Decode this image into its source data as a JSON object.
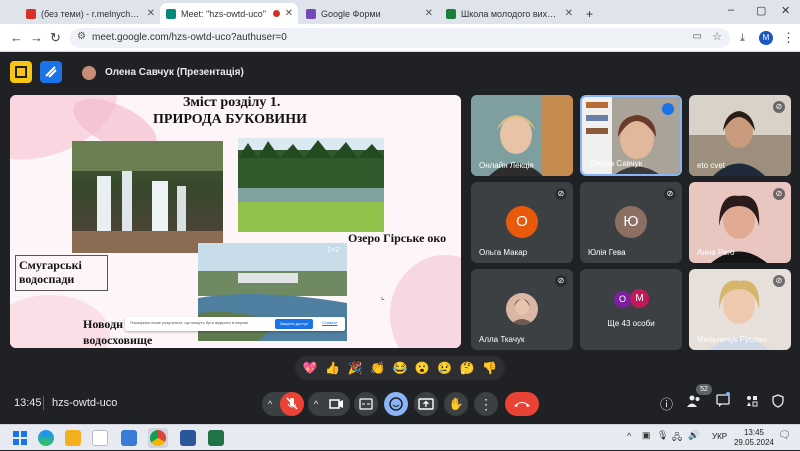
{
  "browser": {
    "tabs": [
      {
        "label": "(без теми) - r.melnychuk@ippo.",
        "favicon_color": "#d93025"
      },
      {
        "label": "Meet: \"hzs-owtd-uco\"",
        "favicon_color": "#00897b",
        "active": true
      },
      {
        "label": "Google Форми",
        "favicon_color": "#7248b9"
      },
      {
        "label": "Школа молодого вихователя",
        "favicon_color": "#188038"
      }
    ],
    "new_tab_label": "+",
    "url": "meet.google.com/hzs-owtd-uco?authuser=0",
    "profile_initial": "M",
    "window_controls": {
      "minimize": "–",
      "maximize": "▢",
      "close": "✕"
    }
  },
  "meet": {
    "presenter_label": "Олена Савчук (Презентація)",
    "slide": {
      "title_line1": "Зміст розділу 1.",
      "title_line2": "ПРИРОДА БУКОВИНИ",
      "caption_lake": "Озеро Гірське око",
      "caption_falls_line1": "Смугарські",
      "caption_falls_line2": "водоспади",
      "caption_reservoir_line1": "Новодн",
      "caption_reservoir_line2": "водосховище",
      "photo_badge": "1+2",
      "notice_text": "Показуємо лише результати, що можуть бути відкрити в мережі.",
      "notice_button": "Закрити доступ",
      "notice_link": "Сховати"
    },
    "participants": [
      {
        "name": "Онлайн Лекція",
        "type": "video",
        "muted": false
      },
      {
        "name": "Олена Савчук",
        "type": "video",
        "muted": false,
        "speaking": true
      },
      {
        "name": "eto cvet",
        "type": "video",
        "muted": true
      },
      {
        "name": "Ольга Макар",
        "type": "avatar",
        "initial": "О",
        "color": "#e8590c",
        "muted": true
      },
      {
        "name": "Юлія Гева",
        "type": "avatar",
        "initial": "Ю",
        "color": "#8d6e63",
        "muted": true
      },
      {
        "name": "Анна Рего",
        "type": "video",
        "muted": true
      },
      {
        "name": "Алла Ткачук",
        "type": "photo",
        "muted": true
      },
      {
        "name": "Ще 43 особи",
        "type": "group",
        "initials": [
          "О",
          "М"
        ],
        "colors": [
          "#7b1fa2",
          "#c2185b"
        ]
      },
      {
        "name": "Мельничук Руслан...",
        "type": "video",
        "muted": true
      }
    ],
    "reactions": [
      "💖",
      "👍",
      "🎉",
      "👏",
      "😂",
      "😮",
      "😢",
      "🤔",
      "👎"
    ],
    "time": "13:45",
    "meeting_code": "hzs-owtd-uco",
    "participants_count": "52",
    "icons": {
      "mic_off": "mic-off-icon",
      "camera": "camera-icon",
      "captions": "captions-icon",
      "emoji": "emoji-icon",
      "present": "present-icon",
      "hand": "raise-hand-icon",
      "more": "more-options-icon",
      "leave": "leave-call-icon"
    }
  },
  "taskbar": {
    "language": "УКР",
    "time": "13:45",
    "date": "29.05.2024"
  }
}
